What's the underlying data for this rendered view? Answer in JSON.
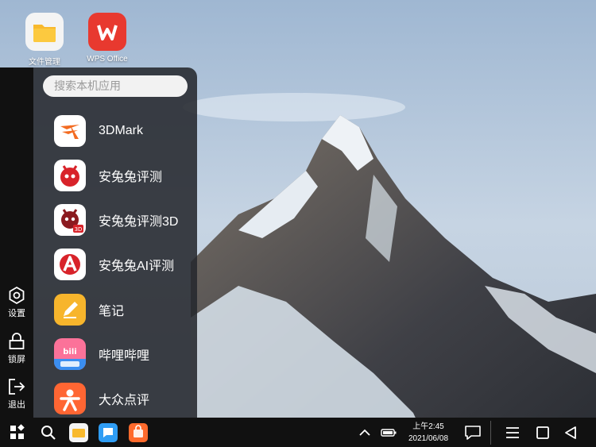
{
  "desktop": {
    "icons": [
      {
        "label": "文件管理",
        "icon": "folder-icon"
      },
      {
        "label": "WPS Office",
        "icon": "wps-icon"
      }
    ]
  },
  "sidebar": {
    "settings_label": "设置",
    "lock_label": "锁屏",
    "exit_label": "退出"
  },
  "launcher": {
    "search_placeholder": "搜索本机应用",
    "apps": [
      {
        "label": "3DMark",
        "icon": "3dmark-icon"
      },
      {
        "label": "安兔兔评测",
        "icon": "antutu-icon"
      },
      {
        "label": "安兔兔评测3D",
        "icon": "antutu-3d-icon"
      },
      {
        "label": "安兔兔AI评测",
        "icon": "antutu-ai-icon"
      },
      {
        "label": "笔记",
        "icon": "notes-icon"
      },
      {
        "label": "哔哩哔哩",
        "icon": "bilibili-icon"
      },
      {
        "label": "大众点评",
        "icon": "dianping-icon"
      }
    ]
  },
  "taskbar": {
    "time": "上午2:45",
    "date": "2021/06/08",
    "pinned": [
      "files-icon",
      "messages-icon",
      "store-icon"
    ]
  },
  "colors": {
    "accent_orange": "#f36b21",
    "antutu_red": "#d8232a",
    "wps_red": "#e8392f",
    "folder_yellow": "#f8b92d"
  }
}
